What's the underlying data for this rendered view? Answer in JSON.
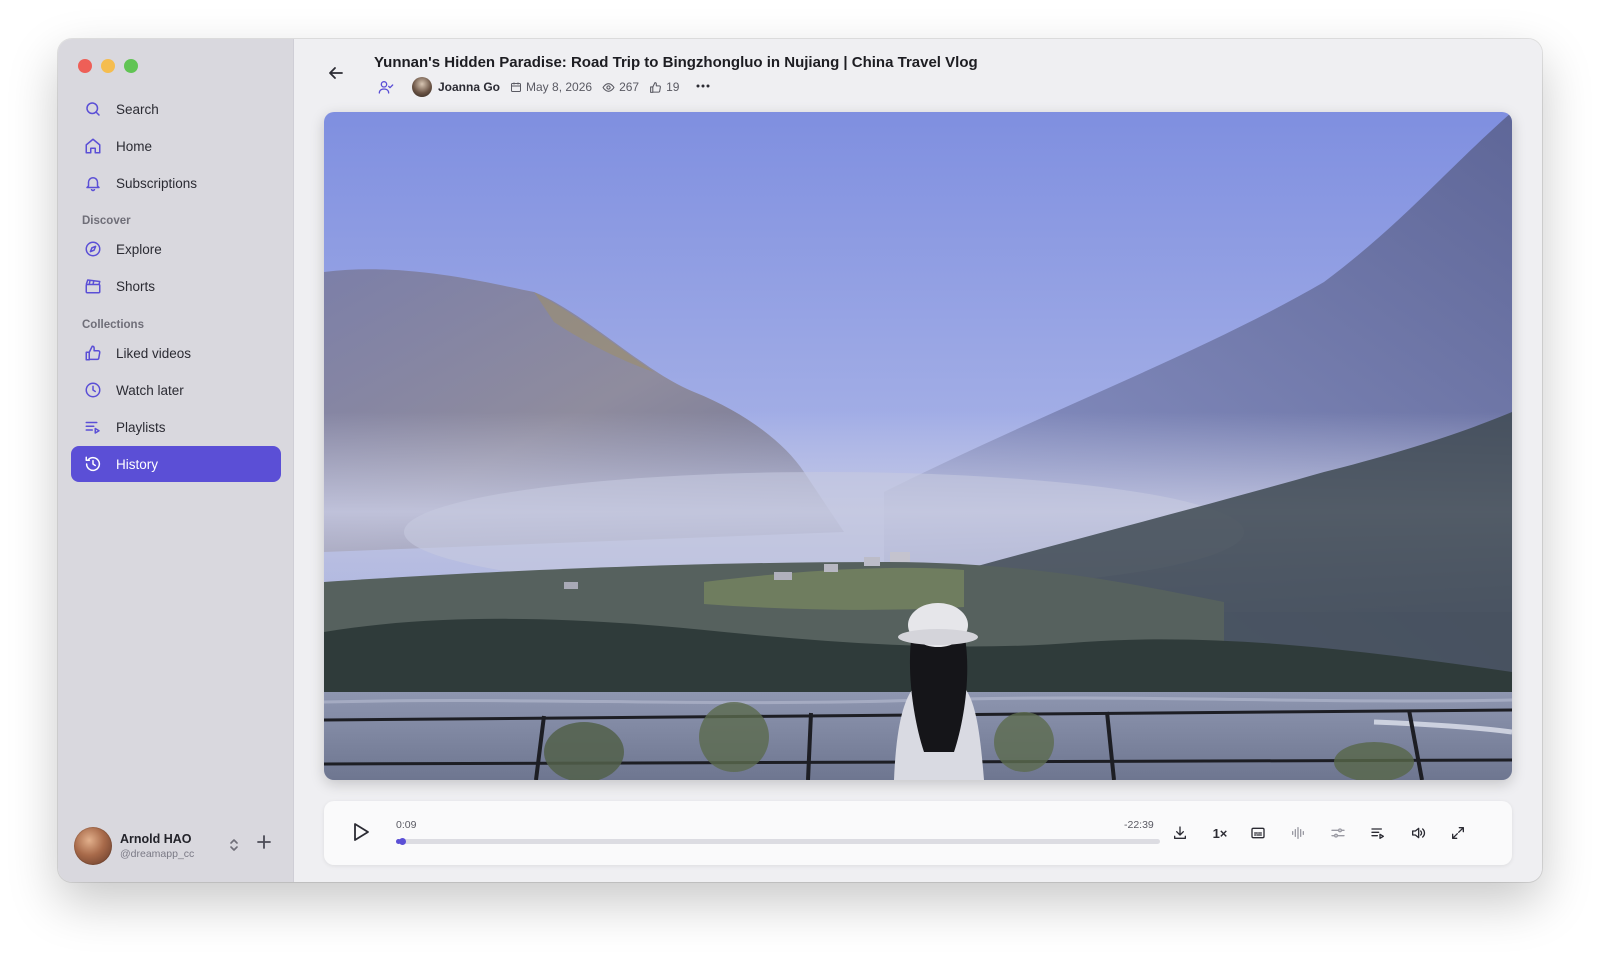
{
  "sidebar": {
    "top_items": [
      {
        "label": "Search",
        "icon": "search-icon"
      },
      {
        "label": "Home",
        "icon": "home-icon"
      },
      {
        "label": "Subscriptions",
        "icon": "bell-icon"
      }
    ],
    "sections": {
      "discover": "Discover",
      "collections": "Collections"
    },
    "discover_items": [
      {
        "label": "Explore",
        "icon": "compass-icon"
      },
      {
        "label": "Shorts",
        "icon": "clapperboard-icon"
      }
    ],
    "collection_items": [
      {
        "label": "Liked videos",
        "icon": "thumbs-up-icon"
      },
      {
        "label": "Watch later",
        "icon": "clock-icon"
      },
      {
        "label": "Playlists",
        "icon": "playlist-icon"
      },
      {
        "label": "History",
        "icon": "history-icon",
        "active": true
      }
    ],
    "user": {
      "name": "Arnold HAO",
      "handle": "@dreamapp_cc"
    }
  },
  "video": {
    "title": "Yunnan's Hidden Paradise: Road Trip to Bingzhongluo in Nujiang | China Travel Vlog",
    "channel": "Joanna Go",
    "date": "May 8, 2026",
    "views": "267",
    "likes": "19"
  },
  "player": {
    "current_time": "0:09",
    "remaining_time": "-22:39",
    "speed": "1×",
    "progress_fraction": 0.0066
  },
  "colors": {
    "accent": "#5b4fd6",
    "sidebar_bg": "#d9d8de",
    "main_bg": "#efeff2"
  }
}
